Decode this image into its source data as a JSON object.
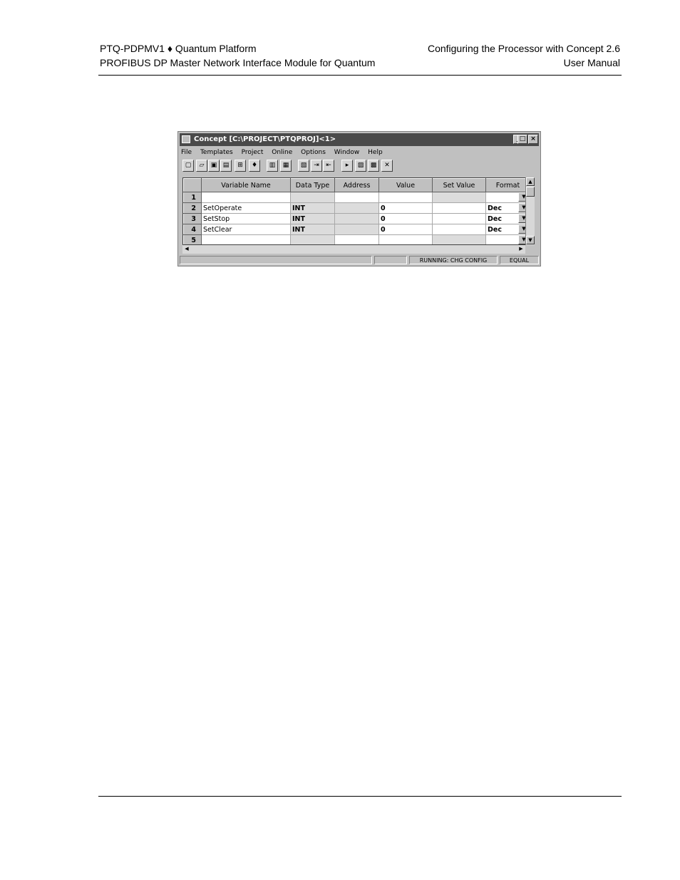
{
  "header": {
    "left_line1": "PTQ-PDPMV1 ♦ Quantum Platform",
    "left_line2": "PROFIBUS DP Master Network Interface Module for Quantum",
    "right_line1": "Configuring the Processor with Concept 2.6",
    "right_line2": "User Manual"
  },
  "window": {
    "title": "Concept [C:\\PROJECT\\PTQPROJ]<1>",
    "buttons": {
      "minimize": "_",
      "maximize": "□",
      "close": "×"
    },
    "menu": [
      "File",
      "Templates",
      "Project",
      "Online",
      "Options",
      "Window",
      "Help"
    ],
    "toolbar_icons": [
      "new-icon",
      "open-icon",
      "save-icon",
      "properties-icon",
      "tree-icon",
      "find-icon",
      "cut-icon",
      "paste-icon",
      "grid-icon",
      "insert-icon",
      "remove-icon",
      "run-icon",
      "read-icon",
      "write-icon",
      "clear-icon"
    ],
    "table": {
      "columns": [
        "Variable Name",
        "Data Type",
        "Address",
        "Value",
        "Set Value",
        "Format"
      ],
      "rows": [
        {
          "num": "1",
          "name": "",
          "type": "",
          "address": "",
          "value": "",
          "set_value": "",
          "format": ""
        },
        {
          "num": "2",
          "name": "SetOperate",
          "type": "INT",
          "address": "",
          "value": "0",
          "set_value": "",
          "format": "Dec"
        },
        {
          "num": "3",
          "name": "SetStop",
          "type": "INT",
          "address": "",
          "value": "0",
          "set_value": "",
          "format": "Dec"
        },
        {
          "num": "4",
          "name": "SetClear",
          "type": "INT",
          "address": "",
          "value": "0",
          "set_value": "",
          "format": "Dec"
        },
        {
          "num": "5",
          "name": "",
          "type": "",
          "address": "",
          "value": "",
          "set_value": "",
          "format": ""
        }
      ]
    },
    "status": {
      "state": "RUNNING: CHG CONFIG",
      "compare": "EQUAL"
    }
  }
}
